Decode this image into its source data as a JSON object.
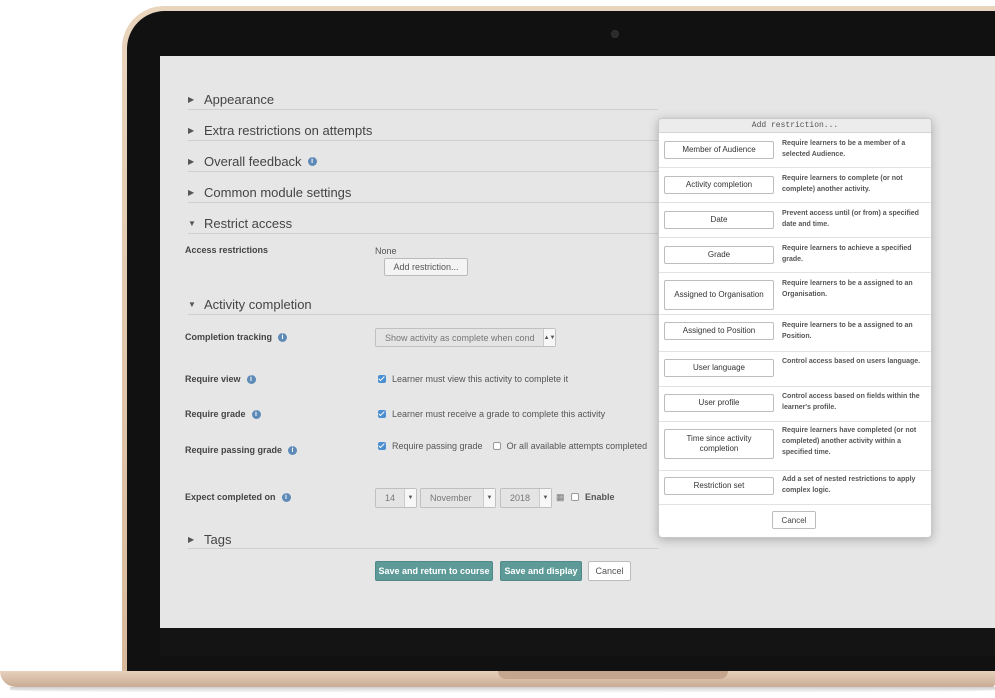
{
  "sections": {
    "appearance": "Appearance",
    "extra_restrictions": "Extra restrictions on attempts",
    "overall_feedback": "Overall feedback",
    "common_module": "Common module settings",
    "restrict_access": "Restrict access",
    "activity_completion": "Activity completion",
    "tags": "Tags"
  },
  "access": {
    "label": "Access restrictions",
    "value": "None",
    "add_button": "Add restriction..."
  },
  "completion": {
    "tracking_label": "Completion tracking",
    "tracking_value": "Show activity as complete when cond",
    "require_view_label": "Require view",
    "require_view_text": "Learner must view this activity to complete it",
    "require_grade_label": "Require grade",
    "require_grade_text": "Learner must receive a grade to complete this activity",
    "require_passing_label": "Require passing grade",
    "require_passing_text": "Require passing grade",
    "or_all_attempts_text": "Or all available attempts completed",
    "expect_label": "Expect completed on",
    "day": "14",
    "month": "November",
    "year": "2018",
    "enable_text": "Enable"
  },
  "buttons": {
    "save_return": "Save and return to course",
    "save_display": "Save and display",
    "cancel": "Cancel"
  },
  "dialog": {
    "title": "Add restriction...",
    "items": [
      {
        "label": "Member of Audience",
        "desc": "Require learners to be a member of a selected Audience."
      },
      {
        "label": "Activity completion",
        "desc": "Require learners to complete (or not complete) another activity."
      },
      {
        "label": "Date",
        "desc": "Prevent access until (or from) a specified date and time."
      },
      {
        "label": "Grade",
        "desc": "Require learners to achieve a specified grade."
      },
      {
        "label": "Assigned to Organisation",
        "desc": "Require learners to be a assigned to an Organisation."
      },
      {
        "label": "Assigned to Position",
        "desc": "Require learners to be a assigned to an Position."
      },
      {
        "label": "User language",
        "desc": "Control access based on users language."
      },
      {
        "label": "User profile",
        "desc": "Control access based on fields within the learner's profile."
      },
      {
        "label": "Time since activity completion",
        "desc": "Require learners have completed (or not completed) another activity within a specified time."
      },
      {
        "label": "Restriction set",
        "desc": "Add a set of nested restrictions to apply complex logic."
      }
    ],
    "cancel": "Cancel"
  },
  "icons": {
    "caret_right": "caret-right-icon",
    "caret_down": "caret-down-icon",
    "info": "info-icon",
    "calendar": "calendar-icon"
  },
  "colors": {
    "primary_button": "#5d9a98",
    "checkbox": "#4b8fd0",
    "info_icon": "#5e8ab8"
  }
}
